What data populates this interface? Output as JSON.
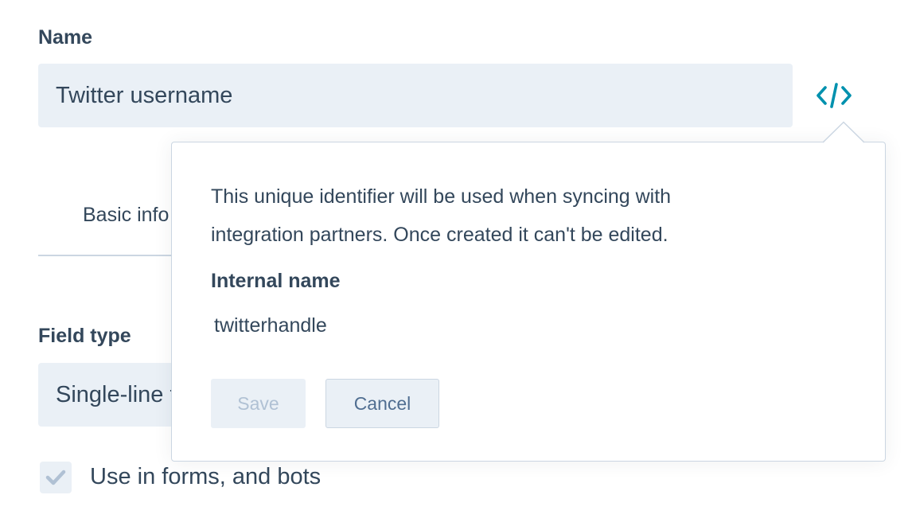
{
  "form": {
    "name_label": "Name",
    "name_value": "Twitter username",
    "tab_label": "Basic info",
    "field_type_label": "Field type",
    "field_type_value": "Single-line text",
    "checkbox_label": "Use in forms, and bots",
    "checkbox_checked": true
  },
  "popover": {
    "description_line1": "This unique identifier will be used when syncing with",
    "description_line2": "integration partners. Once created it can't be edited.",
    "internal_name_label": "Internal name",
    "internal_name_value": "twitterhandle",
    "save_label": "Save",
    "cancel_label": "Cancel"
  },
  "icons": {
    "code_toggle": "code-icon",
    "checkbox_mark": "check-icon"
  },
  "colors": {
    "text": "#33475b",
    "input_bg": "#eaf0f6",
    "border": "#cbd6e2",
    "accent": "#0091ae",
    "disabled_text": "#b0c1d4",
    "secondary_button_text": "#506e91"
  }
}
